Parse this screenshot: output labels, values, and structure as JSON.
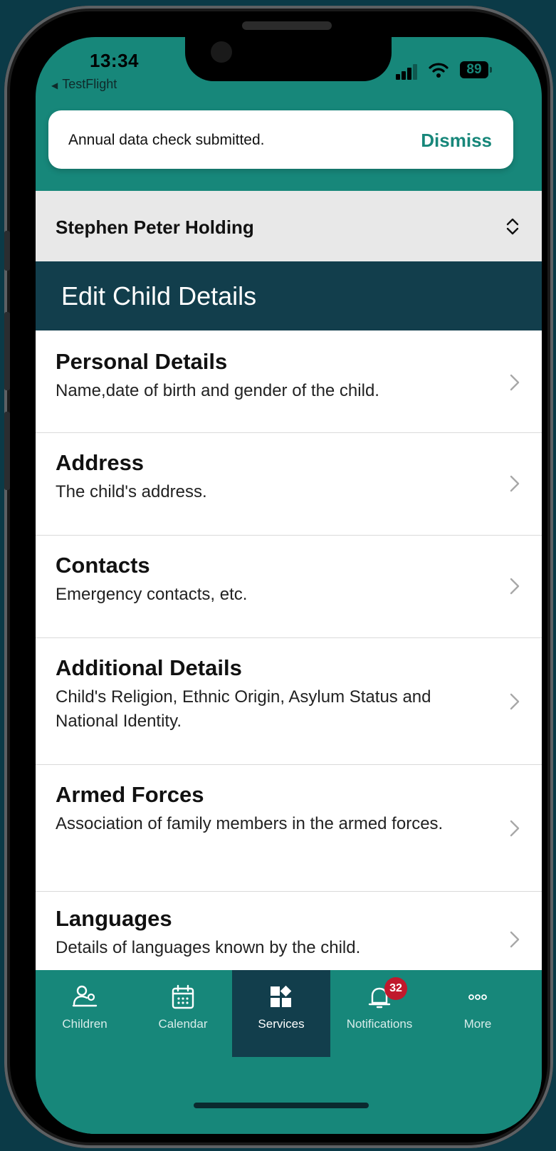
{
  "status_bar": {
    "time": "13:34",
    "back_app": "TestFlight",
    "battery": "89"
  },
  "toast": {
    "message": "Annual data check submitted.",
    "action": "Dismiss"
  },
  "child_selector": {
    "name": "Stephen Peter Holding"
  },
  "page": {
    "title": "Edit Child Details"
  },
  "sections": [
    {
      "title": "Personal Details",
      "description": "Name,date of birth and gender of the child."
    },
    {
      "title": "Address",
      "description": "The child's address."
    },
    {
      "title": "Contacts",
      "description": "Emergency contacts, etc."
    },
    {
      "title": "Additional Details",
      "description": "Child's Religion, Ethnic Origin, Asylum Status and National Identity."
    },
    {
      "title": "Armed Forces",
      "description": "Association of family members in the armed forces."
    },
    {
      "title": "Languages",
      "description": "Details of languages known by the child."
    }
  ],
  "tabs": [
    {
      "label": "Children",
      "icon": "children-icon"
    },
    {
      "label": "Calendar",
      "icon": "calendar-icon"
    },
    {
      "label": "Services",
      "icon": "services-icon",
      "active": true
    },
    {
      "label": "Notifications",
      "icon": "bell-icon",
      "badge": "32"
    },
    {
      "label": "More",
      "icon": "more-icon"
    }
  ],
  "colors": {
    "brand_teal": "#17877a",
    "header_navy": "#123e4c",
    "badge_red": "#c0192c"
  }
}
